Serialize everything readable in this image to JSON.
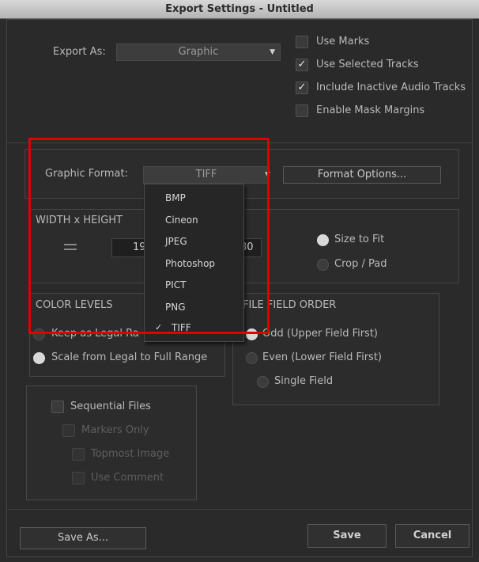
{
  "window": {
    "title": "Export Settings - Untitled"
  },
  "export_as": {
    "label": "Export As:",
    "value": "Graphic"
  },
  "options": [
    {
      "label": "Use Marks",
      "checked": false
    },
    {
      "label": "Use Selected Tracks",
      "checked": true
    },
    {
      "label": "Include Inactive Audio Tracks",
      "checked": true
    },
    {
      "label": "Enable Mask Margins",
      "checked": false
    }
  ],
  "graphic_format": {
    "label": "Graphic Format:",
    "value": "TIFF",
    "options_button": "Format Options...",
    "menu_items": [
      "BMP",
      "Cineon",
      "JPEG",
      "Photoshop",
      "PICT",
      "PNG",
      "TIFF"
    ],
    "selected": "TIFF",
    "checkmark": "✓"
  },
  "size": {
    "header": "WIDTH x HEIGHT",
    "width_partial": "19",
    "height_partial": "80",
    "fit_options": [
      {
        "label": "Size to Fit",
        "selected": true
      },
      {
        "label": "Crop / Pad",
        "selected": false
      }
    ]
  },
  "color_levels": {
    "header": "COLOR LEVELS",
    "options": [
      {
        "label": "Keep as Legal Ra",
        "selected": false
      },
      {
        "label": "Scale from Legal to Full Range",
        "selected": true
      }
    ]
  },
  "field_order": {
    "header": "FILE FIELD ORDER",
    "options": [
      {
        "label": "Odd (Upper Field First)",
        "selected": true
      },
      {
        "label": "Even (Lower Field First)",
        "selected": false
      },
      {
        "label": "Single Field",
        "selected": false
      }
    ]
  },
  "sequence": {
    "sequential_files": "Sequential Files",
    "markers_only": "Markers Only",
    "topmost_image": "Topmost Image",
    "use_comment": "Use Comment"
  },
  "buttons": {
    "save_as": "Save As...",
    "save": "Save",
    "cancel": "Cancel"
  },
  "icons": {
    "check": "✓",
    "dropdown": "▼"
  },
  "colors": {
    "highlight": "#e00000",
    "background": "#2b2b2b"
  }
}
